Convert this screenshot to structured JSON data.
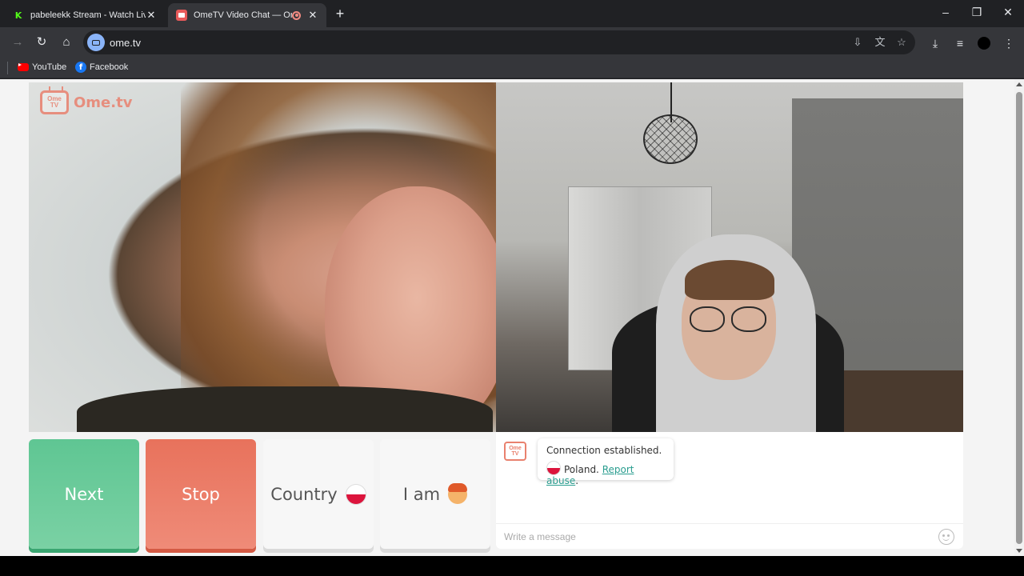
{
  "browser": {
    "tabs": [
      {
        "title": "pabeleekk Stream - Watch Live",
        "active": false
      },
      {
        "title": "OmeTV Video Chat — Ome",
        "active": true
      }
    ],
    "url": "ome.tv",
    "bookmarks": [
      {
        "label": "YouTube",
        "icon": "youtube-icon"
      },
      {
        "label": "Facebook",
        "icon": "facebook-icon"
      }
    ]
  },
  "page": {
    "logo": {
      "tv_line1": "Ome",
      "tv_line2": "TV",
      "text": "Ome.tv"
    },
    "controls": {
      "next": "Next",
      "stop": "Stop",
      "country": "Country",
      "iam": "I am"
    },
    "chat": {
      "logo_line1": "Ome",
      "logo_line2": "TV",
      "status": "Connection established.",
      "country": "Poland.",
      "report": "Report abuse",
      "report_suffix": ".",
      "placeholder": "Write a message"
    }
  },
  "colors": {
    "next": "#5fc693",
    "stop": "#e8725c",
    "brand": "#e9816e",
    "link": "#2a9d8f"
  }
}
